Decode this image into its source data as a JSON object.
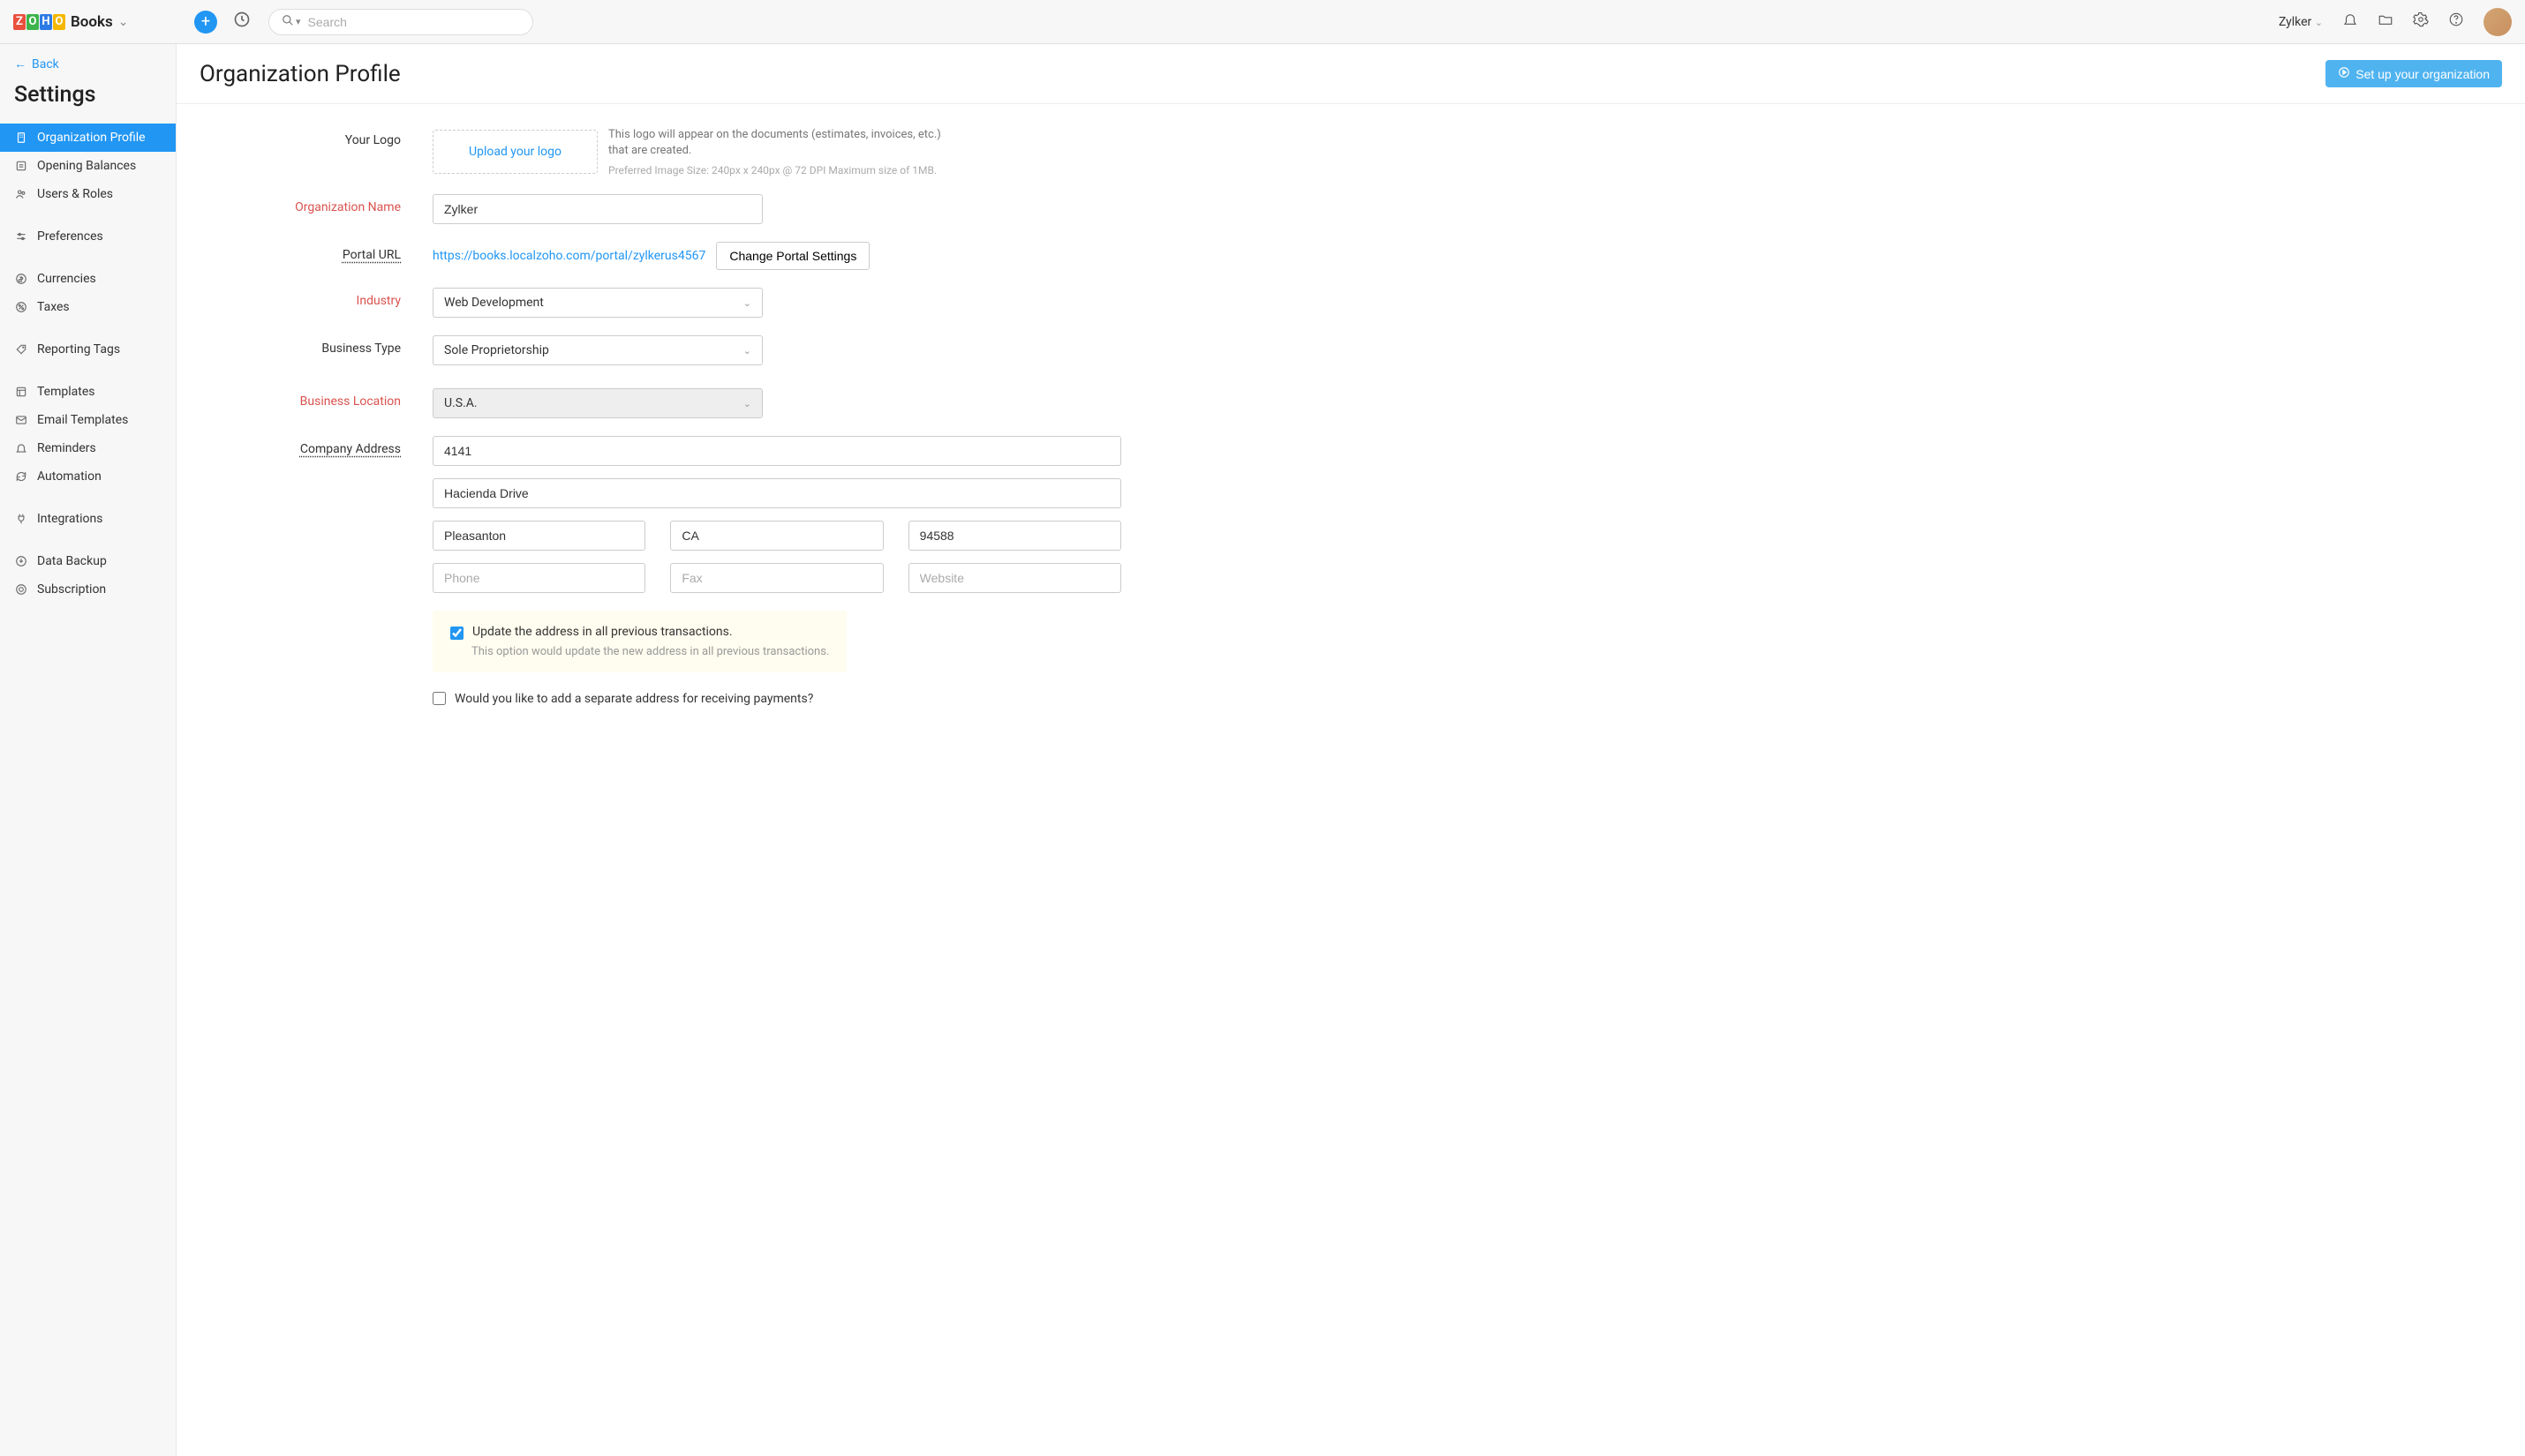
{
  "header": {
    "app_name": "Books",
    "search_placeholder": "Search",
    "org_name": "Zylker"
  },
  "sidebar": {
    "back_label": "Back",
    "title": "Settings",
    "groups": [
      {
        "items": [
          {
            "label": "Organization Profile",
            "icon": "building-icon",
            "active": true
          },
          {
            "label": "Opening Balances",
            "icon": "balance-icon"
          },
          {
            "label": "Users & Roles",
            "icon": "users-icon"
          }
        ]
      },
      {
        "items": [
          {
            "label": "Preferences",
            "icon": "sliders-icon"
          }
        ]
      },
      {
        "items": [
          {
            "label": "Currencies",
            "icon": "currency-icon"
          },
          {
            "label": "Taxes",
            "icon": "percent-icon"
          }
        ]
      },
      {
        "items": [
          {
            "label": "Reporting Tags",
            "icon": "tag-icon"
          }
        ]
      },
      {
        "items": [
          {
            "label": "Templates",
            "icon": "template-icon"
          },
          {
            "label": "Email Templates",
            "icon": "email-icon"
          },
          {
            "label": "Reminders",
            "icon": "bell-icon"
          },
          {
            "label": "Automation",
            "icon": "sync-icon"
          }
        ]
      },
      {
        "items": [
          {
            "label": "Integrations",
            "icon": "plug-icon"
          }
        ]
      },
      {
        "items": [
          {
            "label": "Data Backup",
            "icon": "download-icon"
          },
          {
            "label": "Subscription",
            "icon": "subscription-icon"
          }
        ]
      }
    ]
  },
  "page": {
    "title": "Organization Profile",
    "setup_button": "Set up your organization"
  },
  "form": {
    "logo_label": "Your Logo",
    "upload_label": "Upload your logo",
    "logo_hint_main": "This logo will appear on the documents (estimates, invoices, etc.) that are created.",
    "logo_hint_sub": "Preferred Image Size: 240px x 240px @ 72 DPI Maximum size of 1MB.",
    "org_name_label": "Organization Name",
    "org_name_value": "Zylker",
    "portal_label": "Portal URL",
    "portal_url": "https://books.localzoho.com/portal/zylkerus4567",
    "portal_button": "Change Portal Settings",
    "industry_label": "Industry",
    "industry_value": "Web Development",
    "biztype_label": "Business Type",
    "biztype_value": "Sole Proprietorship",
    "bizloc_label": "Business Location",
    "bizloc_value": "U.S.A.",
    "address_label": "Company Address",
    "address": {
      "street1": "4141",
      "street2": "Hacienda Drive",
      "city": "Pleasanton",
      "state": "CA",
      "zip": "94588",
      "phone_ph": "Phone",
      "fax_ph": "Fax",
      "website_ph": "Website"
    },
    "update_checkbox": "Update the address in all previous transactions.",
    "update_sub": "This option would update the new address in all previous transactions.",
    "separate_address": "Would you like to add a separate address for receiving payments?"
  }
}
